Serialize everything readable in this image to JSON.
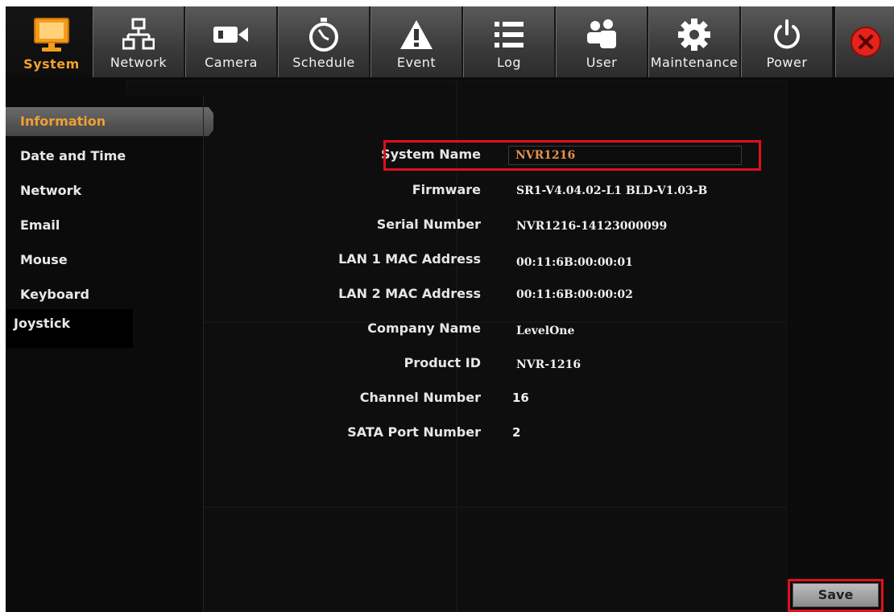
{
  "toolbar": {
    "tabs": [
      {
        "label": "System",
        "icon": "monitor-icon"
      },
      {
        "label": "Network",
        "icon": "network-icon"
      },
      {
        "label": "Camera",
        "icon": "camera-icon"
      },
      {
        "label": "Schedule",
        "icon": "stopwatch-icon"
      },
      {
        "label": "Event",
        "icon": "warning-icon"
      },
      {
        "label": "Log",
        "icon": "list-icon"
      },
      {
        "label": "User",
        "icon": "users-icon"
      },
      {
        "label": "Maintenance",
        "icon": "gear-icon"
      },
      {
        "label": "Power",
        "icon": "power-icon"
      }
    ],
    "active": "System",
    "close_icon": "close-icon"
  },
  "sidebar": {
    "items": [
      {
        "label": "Information"
      },
      {
        "label": "Date and Time"
      },
      {
        "label": "Network"
      },
      {
        "label": "Email"
      },
      {
        "label": "Mouse"
      },
      {
        "label": "Keyboard"
      },
      {
        "label": "Joystick"
      }
    ],
    "active": "Information"
  },
  "info": {
    "system_name_label": "System Name",
    "system_name_value": "NVR1216",
    "firmware_label": "Firmware",
    "firmware_value": "SR1-V4.04.02-L1 BLD-V1.03-B",
    "serial_label": "Serial Number",
    "serial_value": "NVR1216-14123000099",
    "lan1_label": "LAN 1 MAC Address",
    "lan1_value": "00:11:6B:00:00:01",
    "lan2_label": "LAN 2 MAC Address",
    "lan2_value": "00:11:6B:00:00:02",
    "company_label": "Company Name",
    "company_value": "LevelOne",
    "product_label": "Product ID",
    "product_value": "NVR-1216",
    "channel_label": "Channel Number",
    "channel_value": "16",
    "sata_label": "SATA Port Number",
    "sata_value": "2"
  },
  "actions": {
    "save_label": "Save"
  },
  "colors": {
    "accent": "#f0a030",
    "highlight": "#e0101a",
    "input_text": "#e8904a",
    "background": "#0b0b0b"
  }
}
